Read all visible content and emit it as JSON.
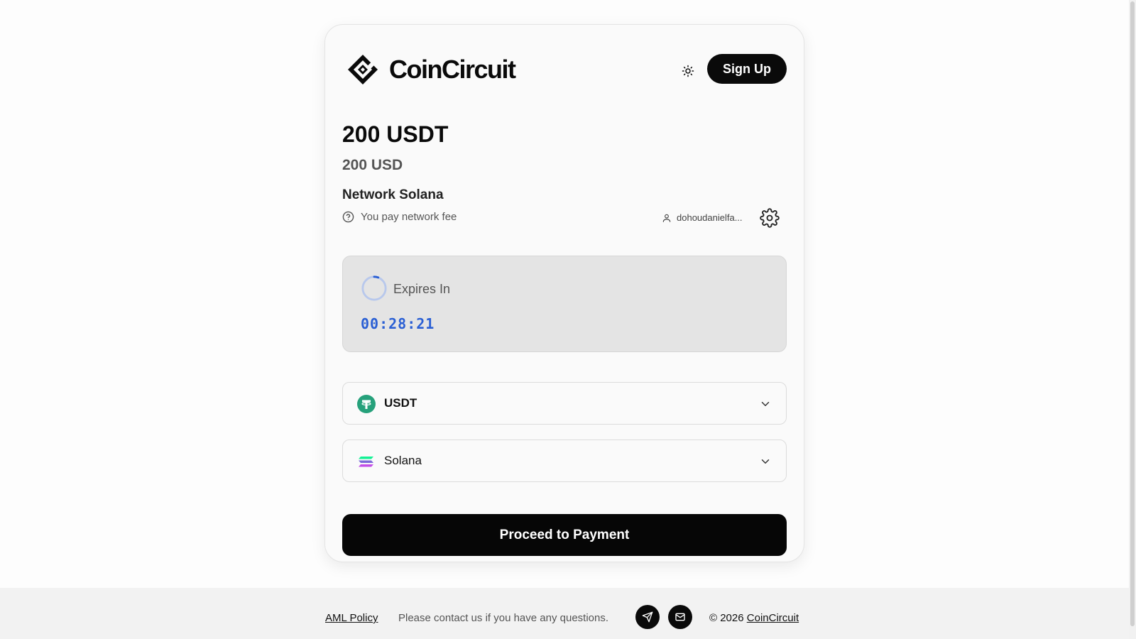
{
  "header": {
    "brand_name": "CoinCircuit",
    "signup_label": "Sign Up"
  },
  "payment": {
    "amount_crypto": "200 USDT",
    "amount_fiat": "200 USD",
    "network_label": "Network Solana",
    "fee_note": "You pay network fee",
    "user_label": "dohoudanielfa..."
  },
  "timer": {
    "label": "Expires In",
    "value": "00:28:21"
  },
  "selectors": {
    "currency": {
      "label": "USDT",
      "icon": "tether-icon"
    },
    "network": {
      "label": "Solana",
      "icon": "solana-icon"
    }
  },
  "actions": {
    "proceed_label": "Proceed to Payment"
  },
  "footer": {
    "aml_label": "AML Policy",
    "contact_text": "Please contact us if you have any questions.",
    "copyright_prefix": "© 2026",
    "copyright_link": "CoinCircuit"
  },
  "colors": {
    "accent_blue": "#2a5fd4",
    "tether_green": "#26a17b",
    "button_black": "#0a0a0a"
  }
}
